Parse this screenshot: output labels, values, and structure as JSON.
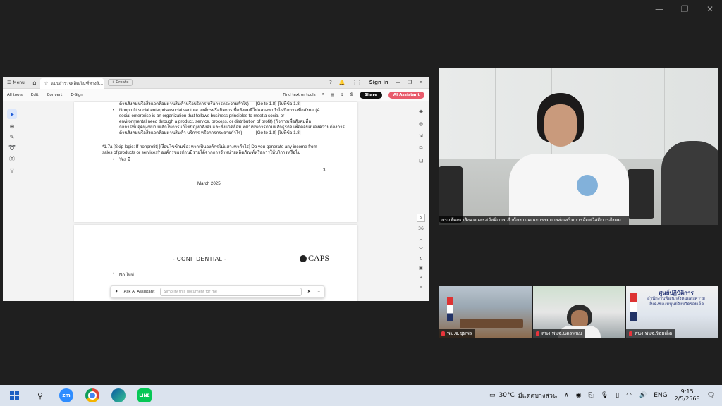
{
  "pdf": {
    "menu_label": "Menu",
    "tab_title": "แบบสำรวจผลิตภัณฑ์ทางสั...",
    "create_label": "Create",
    "signin_label": "Sign in",
    "toolbar": {
      "all_tools": "All tools",
      "edit": "Edit",
      "convert": "Convert",
      "esign": "E-Sign",
      "find_placeholder": "Find text or tools",
      "share": "Share",
      "ai_assistant": "AI Assistant"
    },
    "page1": {
      "line0": "ด้านสังคมหรือสิ่งแวดล้อมผ่านสินค้าหรือบริการ หรือการกระจายกำไร)",
      "line0_goto": "[Go to 1.8] [ไปที่ข้อ 1.8]",
      "bullet_line1": "Nonprofit social enterprise/social venture องค์กรหรือกิจการเพื่อสังคมที่ไม่แสวงหากำไร/กิจการเพื่อสังคม (A",
      "line2": "social enterprise is an organization that follows business principles to meet a social or",
      "line3": "environmental need through a product, service, process, or distribution of profit) (กิจการเพื่อสังคมคือ",
      "line4": "กิจการที่มีจุดมุ่งหมายหลักในการแก้ไขปัญหาสังคมและสิ่งแวดล้อม ที่ดำเนินการตามหลักธุรกิจ เพื่อตอบสนองความต้องการ",
      "line5": "ด้านสังคมหรือสิ่งแวดล้อมผ่านสินค้า บริการ หรือการกระจายกำไร)",
      "line5_goto": "[Go to 1.8] [ไปที่ข้อ 1.8]",
      "q17a_line1": "*1.7a [Skip logic: If nonprofit] [เงื่อนไขข้ามข้อ: หากเป็นองค์กรไม่แสวงหากำไร] Do you generate any income from",
      "q17a_line2": "sales of products or services? องค์กรของท่านมีรายได้จากการจำหน่ายผลิตภัณฑ์หรือการให้บริการหรือไม่",
      "yes_option": "Yes มี",
      "page_number": "3",
      "footer_date": "March 2025"
    },
    "page2": {
      "confidential": "- CONFIDENTIAL -",
      "logo_text": "CAPS",
      "no_option": "No ไม่มี"
    },
    "ask_ai": {
      "label": "Ask AI Assistant",
      "placeholder": "Simplify this document for me"
    },
    "scroll": {
      "current_page": "5",
      "total_pages": "36"
    }
  },
  "video": {
    "main_label": "กรมพัฒนาสังคมและสวัสดิการ สำนักงานคณะกรรมการส่งเสริมการจัดสวัสดิการสังคม...",
    "thumbs": [
      {
        "label": "พม.จ.ชุมพร"
      },
      {
        "label": "สนง.พมจ.นครพนม"
      },
      {
        "label": "สนง.พมจ.ร้อยเอ็ด"
      }
    ],
    "thumb3_sign_title": "ศูนย์ปฏิบัติการ",
    "thumb3_sign_sub": "สำนักงานพัฒนาสังคมและความมั่นคงของมนุษย์จังหวัดร้อยเอ็ด"
  },
  "taskbar": {
    "zoom_label": "zm",
    "line_label": "LINE",
    "temperature": "30°C",
    "weather_text": "มีแดดบางส่วน",
    "language": "ENG",
    "time": "9:15",
    "date": "2/5/2568"
  }
}
